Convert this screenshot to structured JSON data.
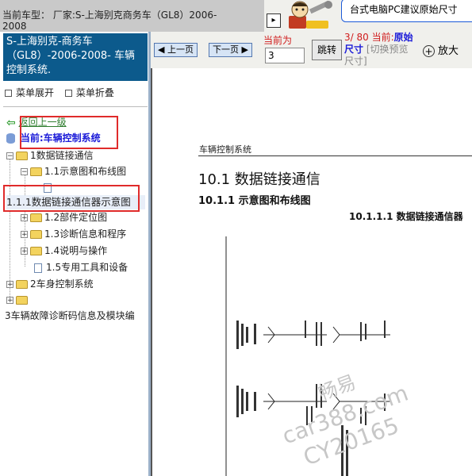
{
  "top_bar": {
    "current_model": "当前车型： 厂家:S-上海别克商务车（GL8）2006-2008",
    "expand_glyph": "▸",
    "pc_tip": "台式电脑PC建议原始尺寸"
  },
  "left_panel": {
    "title": "S-上海别克-商务车（GL8）-2006-2008- 车辆控制系统.",
    "menu_expand": "菜单展开",
    "menu_collapse": "菜单折叠",
    "back_label": "返回上一级",
    "current_label": "当前:车辆控制系统",
    "tree": [
      {
        "label": "1数据链接通信"
      },
      {
        "label": "1.1示意图和布线图"
      },
      {
        "label": ""
      },
      {
        "label": "1.1.1数据链接通信器示意图"
      },
      {
        "label": "1.2部件定位图"
      },
      {
        "label": "1.3诊断信息和程序"
      },
      {
        "label": "1.4说明与操作"
      },
      {
        "label": "1.5专用工具和设备"
      },
      {
        "label": "2车身控制系统"
      },
      {
        "label": ""
      },
      {
        "label": "3车辆故障诊断码信息及模块编"
      }
    ]
  },
  "toolbar": {
    "prev": "上一页",
    "next": "下一页",
    "current_label": "当前为",
    "page_value": "3",
    "jump": "跳转",
    "page_number": "3/ 80",
    "current_prefix": "当前:",
    "original": "原始",
    "size_word": "尺寸",
    "switch_preview": "[切换预览",
    "size_suffix": "尺寸]",
    "zoom": "放大"
  },
  "document": {
    "section": "车辆控制系统",
    "heading1": "10.1 数据链接通信",
    "heading2": "10.1.1 示意图和布线图",
    "heading3": "10.1.1.1 数据链接通信器"
  },
  "watermark": {
    "line1": "畅易",
    "line2": "car388.com",
    "line3": "CY20165"
  },
  "colors": {
    "title_bg": "#0c5a8c",
    "highlight_border": "#e02b2b",
    "nav_button": "#d6e4f5",
    "page_red": "#d01c1c",
    "link_blue": "#1b1bd8"
  }
}
